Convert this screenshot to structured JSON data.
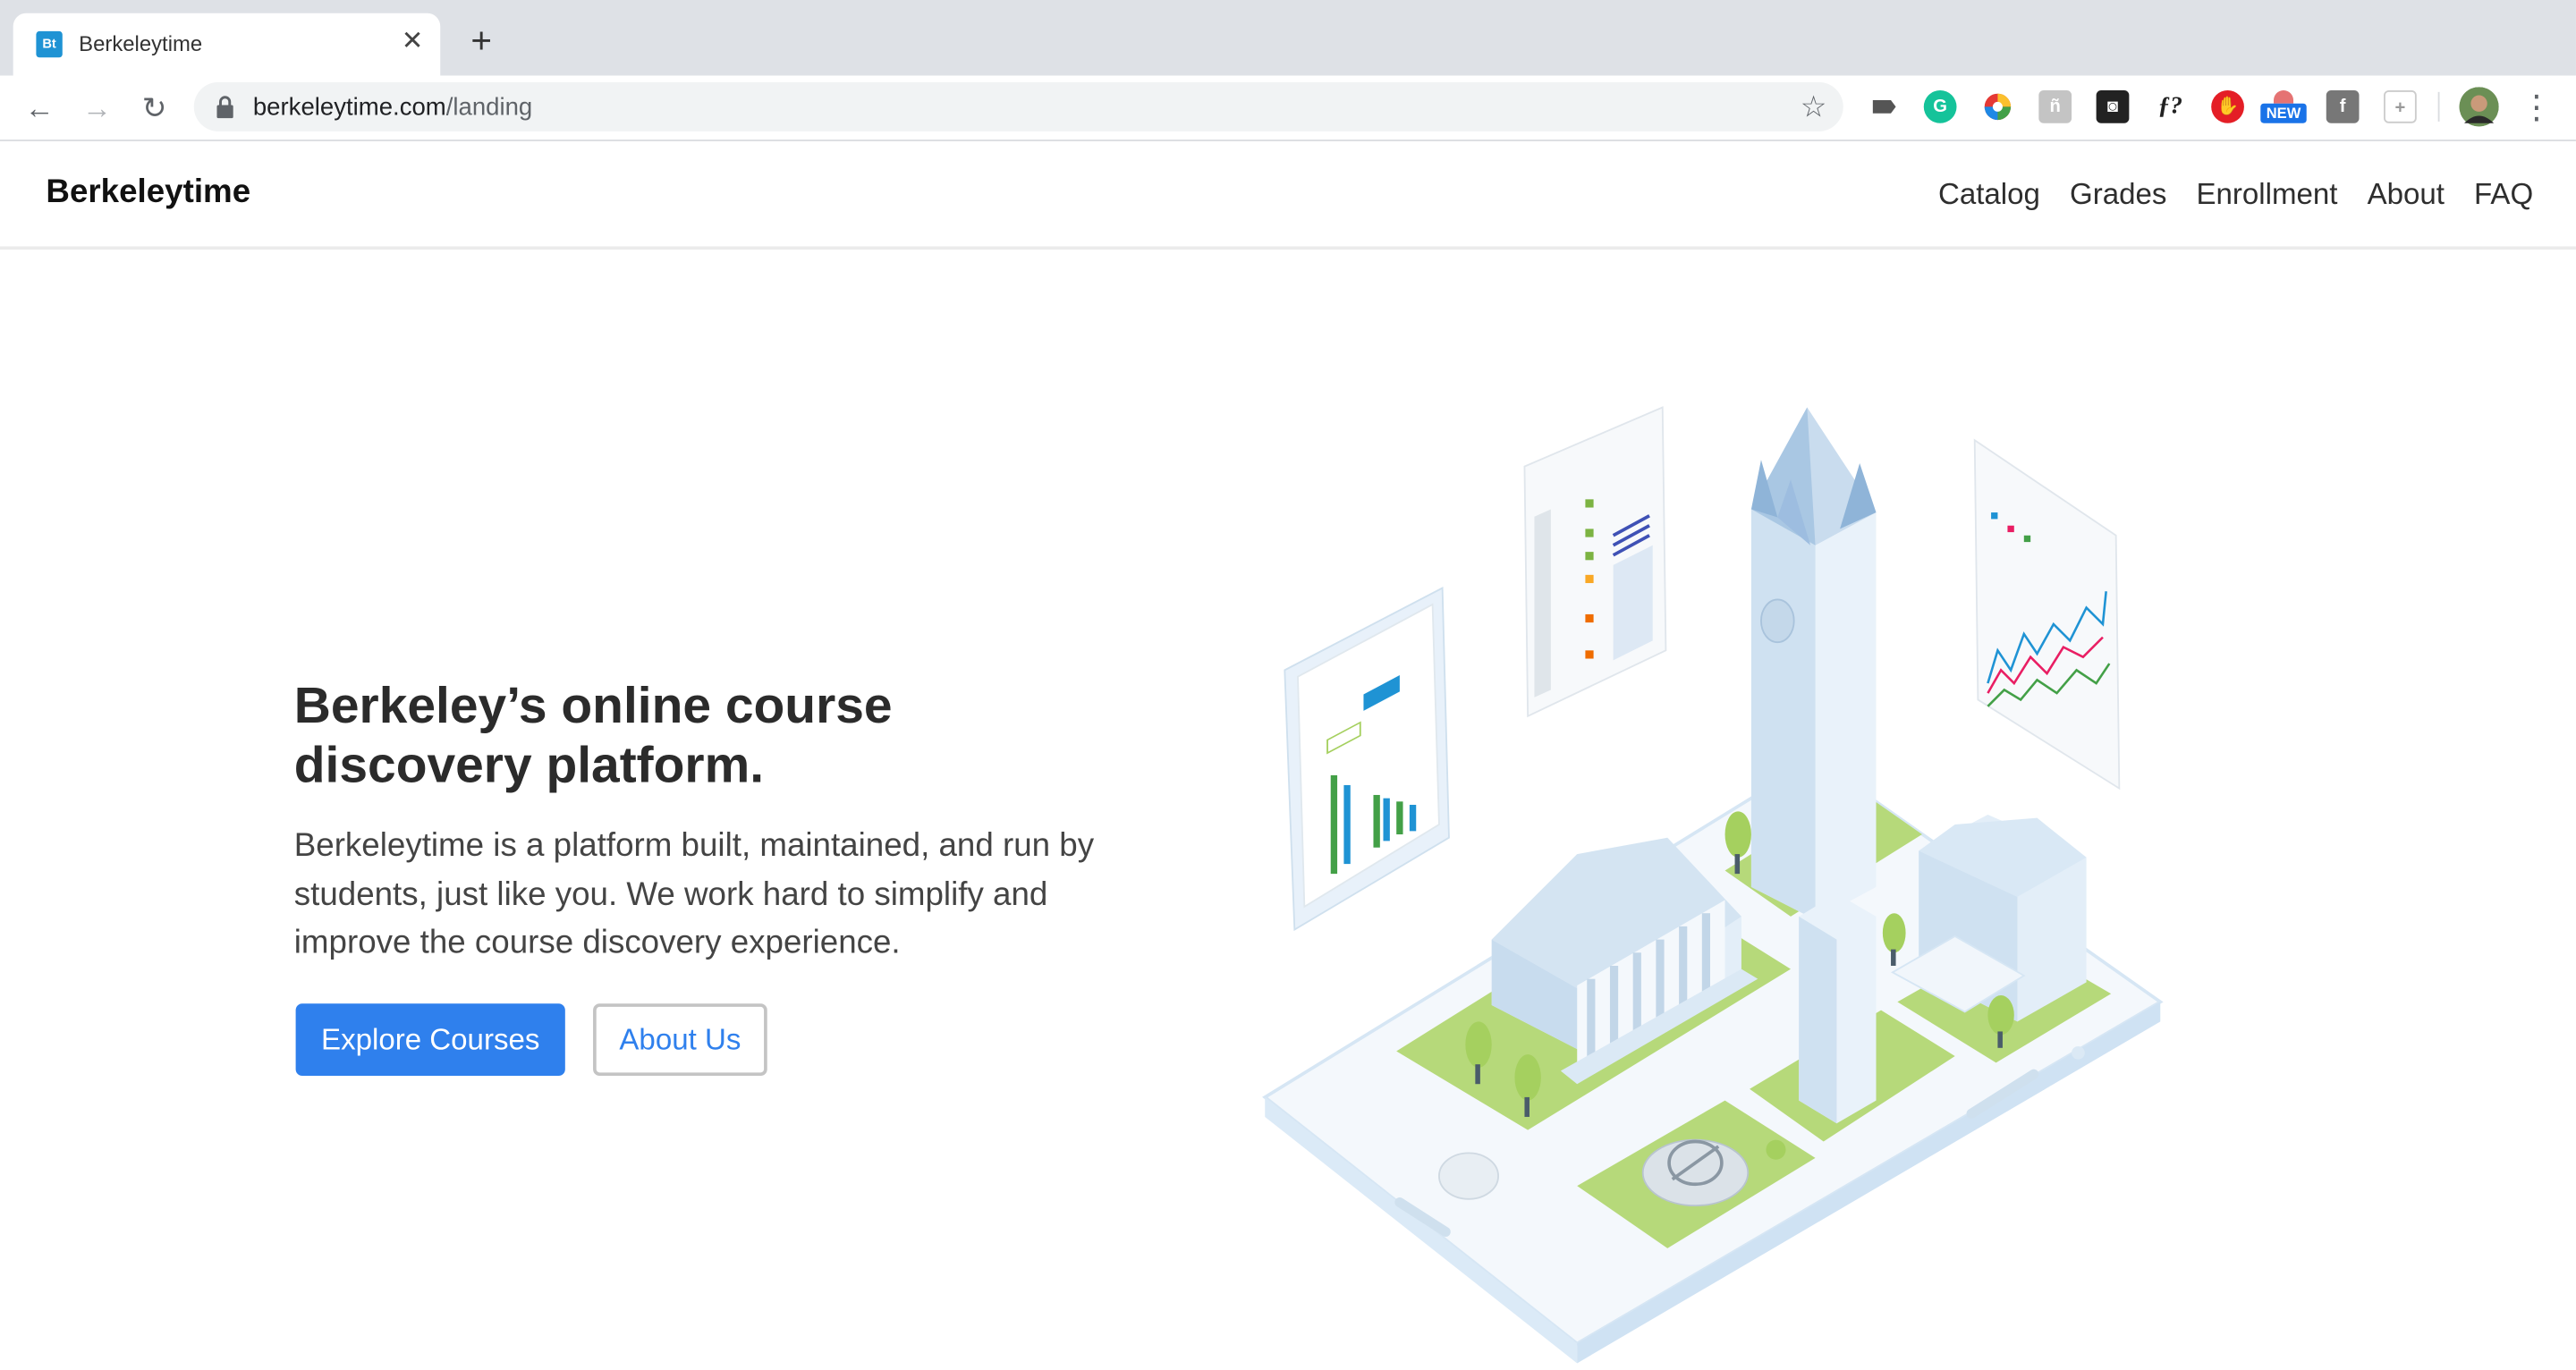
{
  "browser": {
    "tab": {
      "favicon_text": "Bt",
      "title": "Berkeleytime"
    },
    "url_host": "berkeleytime.com",
    "url_path": "/landing",
    "extensions": [
      "tag-icon",
      "grammarly-icon",
      "color-wheel-icon",
      "tool-icon",
      "search-box-icon",
      "font-icon",
      "adblock-icon",
      "new-badge-icon",
      "facebook-icon",
      "pin-icon"
    ],
    "new_badge": "NEW"
  },
  "site": {
    "brand": "Berkeleytime",
    "nav": [
      "Catalog",
      "Grades",
      "Enrollment",
      "About",
      "FAQ"
    ]
  },
  "hero": {
    "title": "Berkeley’s online course discovery platform.",
    "text": "Berkeleytime is a platform built, maintained, and run by students, just like you. We work hard to simplify and improve the course discovery experience.",
    "primary_button": "Explore Courses",
    "secondary_button": "About Us"
  },
  "colors": {
    "accent": "#2f80ed",
    "brand_favicon": "#1f93d4",
    "grass": "#b6d97a",
    "building": "#dbe9f5"
  }
}
